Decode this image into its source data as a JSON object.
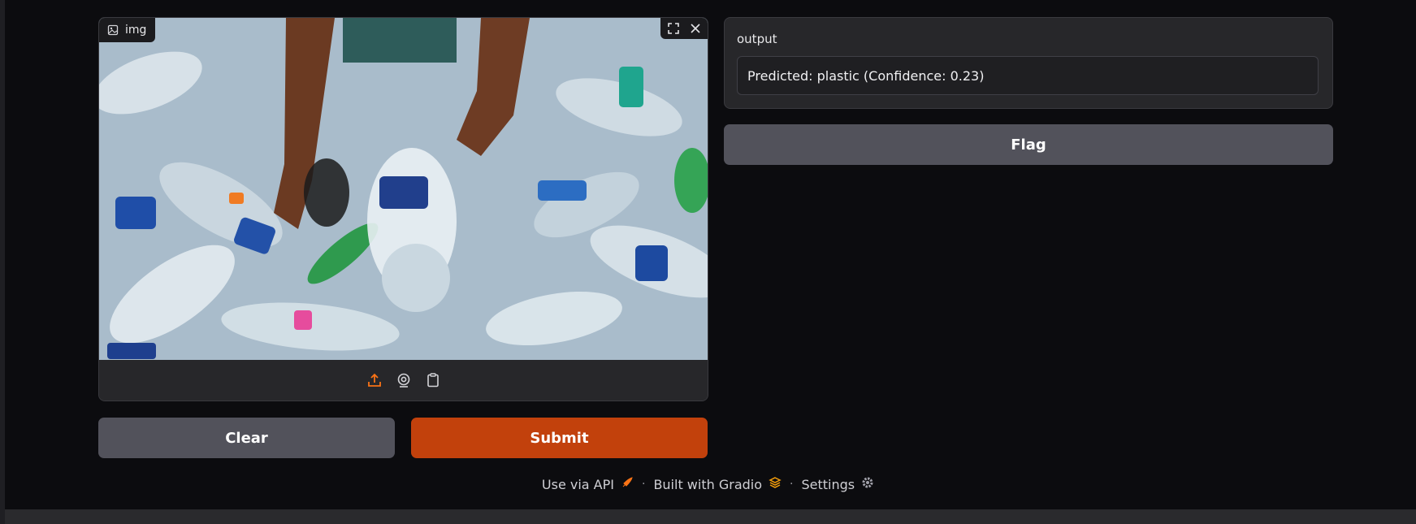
{
  "image_input": {
    "label": "img",
    "icons": {
      "label_icon": "image-icon",
      "fullscreen": "fullscreen-icon",
      "clear": "close-icon",
      "upload": "upload-icon",
      "webcam": "webcam-icon",
      "clipboard": "clipboard-icon"
    }
  },
  "output": {
    "label": "output",
    "value": "Predicted: plastic (Confidence: 0.23)"
  },
  "buttons": {
    "clear": "Clear",
    "submit": "Submit",
    "flag": "Flag"
  },
  "footer": {
    "api": "Use via API",
    "built": "Built with Gradio",
    "settings": "Settings",
    "separator": "·"
  },
  "colors": {
    "accent": "#c2410c",
    "upload_icon": "#f97316",
    "secondary_button": "#52525b",
    "background": "#0c0c0f"
  }
}
